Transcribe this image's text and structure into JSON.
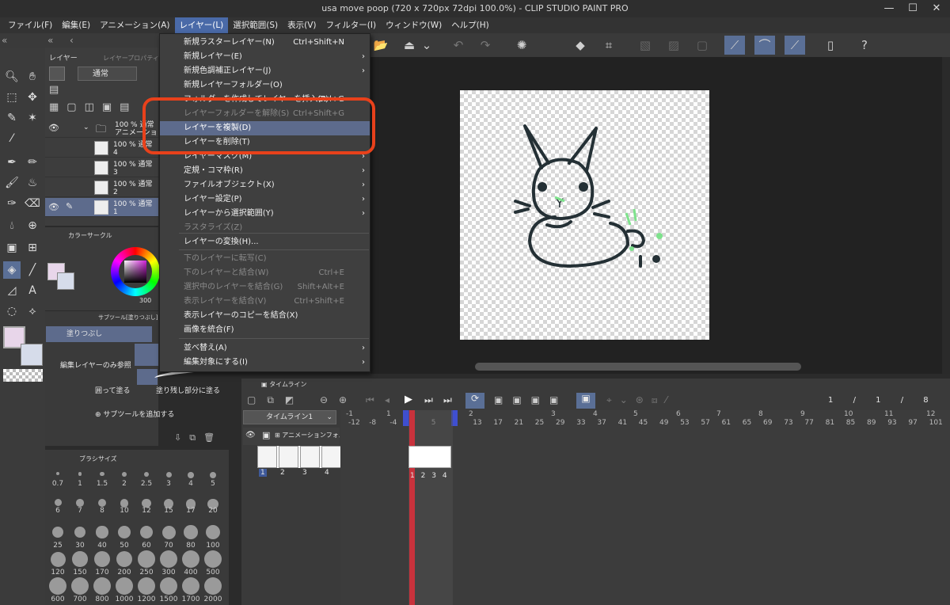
{
  "window": {
    "title": "usa move poop (720 x 720px 72dpi 100.0%) - CLIP STUDIO PAINT PRO",
    "minimize": "—",
    "maximize": "☐",
    "close": "✕"
  },
  "menubar": [
    "ファイル(F)",
    "編集(E)",
    "アニメーション(A)",
    "レイヤー(L)",
    "選択範囲(S)",
    "表示(V)",
    "フィルター(I)",
    "ウィンドウ(W)",
    "ヘルプ(H)"
  ],
  "layer_menu": {
    "items": [
      {
        "label": "新規ラスターレイヤー(N)",
        "shortcut": "Ctrl+Shift+N",
        "submenu": false,
        "disabled": false
      },
      {
        "label": "新規レイヤー(E)",
        "shortcut": "",
        "submenu": true,
        "disabled": false
      },
      {
        "label": "新規色調補正レイヤー(J)",
        "shortcut": "",
        "submenu": true,
        "disabled": false
      },
      {
        "label": "新規レイヤーフォルダー(O)",
        "shortcut": "",
        "submenu": false,
        "disabled": false
      },
      {
        "label": "フォルダーを作成してレイヤーを挿入(F)",
        "shortcut": "Ctrl+G",
        "submenu": false,
        "disabled": false
      },
      {
        "label": "レイヤーフォルダーを解除(S)",
        "shortcut": "Ctrl+Shift+G",
        "submenu": false,
        "disabled": true
      },
      {
        "label": "レイヤーを複製(D)",
        "shortcut": "",
        "submenu": false,
        "disabled": false,
        "selected": true
      },
      {
        "label": "レイヤーを削除(T)",
        "shortcut": "",
        "submenu": false,
        "disabled": false
      },
      {
        "label": "レイヤーマスク(M)",
        "shortcut": "",
        "submenu": true,
        "disabled": false
      },
      {
        "label": "定規・コマ枠(R)",
        "shortcut": "",
        "submenu": true,
        "disabled": false
      },
      {
        "label": "ファイルオブジェクト(X)",
        "shortcut": "",
        "submenu": true,
        "disabled": false
      },
      {
        "label": "レイヤー設定(P)",
        "shortcut": "",
        "submenu": true,
        "disabled": false
      },
      {
        "label": "レイヤーから選択範囲(Y)",
        "shortcut": "",
        "submenu": true,
        "disabled": false
      },
      {
        "label": "ラスタライズ(Z)",
        "shortcut": "",
        "submenu": false,
        "disabled": true
      },
      {
        "label": "レイヤーの変換(H)...",
        "shortcut": "",
        "submenu": false,
        "disabled": false
      },
      {
        "label": "下のレイヤーに転写(C)",
        "shortcut": "",
        "submenu": false,
        "disabled": true
      },
      {
        "label": "下のレイヤーと結合(W)",
        "shortcut": "Ctrl+E",
        "submenu": false,
        "disabled": true
      },
      {
        "label": "選択中のレイヤーを結合(G)",
        "shortcut": "Shift+Alt+E",
        "submenu": false,
        "disabled": true
      },
      {
        "label": "表示レイヤーを結合(V)",
        "shortcut": "Ctrl+Shift+E",
        "submenu": false,
        "disabled": true
      },
      {
        "label": "表示レイヤーのコピーを結合(X)",
        "shortcut": "",
        "submenu": false,
        "disabled": false
      },
      {
        "label": "画像を統合(F)",
        "shortcut": "",
        "submenu": false,
        "disabled": false
      },
      {
        "label": "並べ替え(A)",
        "shortcut": "",
        "submenu": true,
        "disabled": false
      },
      {
        "label": "編集対象にする(I)",
        "shortcut": "",
        "submenu": true,
        "disabled": false
      }
    ]
  },
  "layer_panel": {
    "tab1": "レイヤー",
    "tab2": "レイヤープロパティ",
    "blend_mode": "通常",
    "layers": [
      {
        "opacity": "100 %",
        "mode": "通常",
        "name": "アニメーションフォルダー",
        "folder": true
      },
      {
        "opacity": "100 %",
        "mode": "通常",
        "name": "4"
      },
      {
        "opacity": "100 %",
        "mode": "通常",
        "name": "3"
      },
      {
        "opacity": "100 %",
        "mode": "通常",
        "name": "2"
      },
      {
        "opacity": "100 %",
        "mode": "通常",
        "name": "1",
        "selected": true
      }
    ]
  },
  "color_panel": {
    "title": "カラーサークル",
    "value": "300"
  },
  "subtool_panel": {
    "title": "サブツール[塗りつぶし]",
    "selected_tool": "塗りつぶし",
    "option1": "編集レイヤーのみ参照",
    "option2": "囲って塗る",
    "option3": "塗り残し部分に塗る",
    "add_label": "サブツールを追加する"
  },
  "brush_panel": {
    "title": "ブラシサイズ",
    "sizes": [
      "0.7",
      "1",
      "1.5",
      "2",
      "2.5",
      "3",
      "4",
      "5",
      "6",
      "7",
      "8",
      "10",
      "12",
      "15",
      "17",
      "20",
      "25",
      "30",
      "40",
      "50",
      "60",
      "70",
      "80",
      "100",
      "120",
      "150",
      "170",
      "200",
      "250",
      "300",
      "400",
      "500",
      "600",
      "700",
      "800",
      "1000",
      "1200",
      "1500",
      "1700",
      "2000"
    ]
  },
  "timeline": {
    "tab": "タイムライン",
    "timeline_name": "タイムライン1",
    "counter1": "1",
    "counter2": "1",
    "counter3": "8",
    "slash": "/",
    "track_name": "アニメーションフォルダー",
    "cel_labels": [
      "1",
      "2",
      "3",
      "4"
    ],
    "ruler_top": [
      "-1",
      "1",
      "2",
      "3",
      "4",
      "5",
      "6",
      "7",
      "8",
      "9",
      "10",
      "11",
      "12"
    ],
    "ruler_bottom": [
      "-12",
      "-8",
      "-4",
      "1",
      "5",
      "9",
      "13",
      "17",
      "21",
      "25",
      "29",
      "33",
      "37",
      "41",
      "45",
      "49",
      "53",
      "57",
      "61",
      "65",
      "69",
      "73",
      "77",
      "81",
      "85",
      "89",
      "93",
      "97",
      "101"
    ],
    "frame_labels": [
      "1",
      "2",
      "3",
      "4"
    ]
  },
  "colors": {
    "menu_bg": "#3f3f3f",
    "selected": "#5d6b8c",
    "highlight_stroke": "#e8411b",
    "accent": "#4a6aa8",
    "main_color": "#e8d6ea",
    "sub_color": "#d6dcea",
    "playhead": "#c8323c"
  }
}
